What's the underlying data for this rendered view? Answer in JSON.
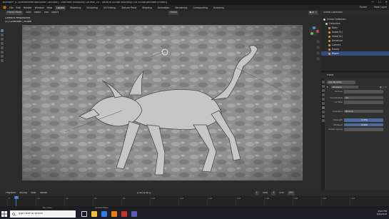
{
  "window": {
    "title": "Blender* [C:\\BlenderMentals\\New Concept] - Ultimate Sculpting Course\\ 20 - Second Sculpt Blocking Out Sculpt\\Blender\\Edited]",
    "controls": [
      "—",
      "☐",
      "✕"
    ]
  },
  "menubar": {
    "items": [
      "File",
      "Edit",
      "Render",
      "Window",
      "Help"
    ],
    "workspaces": [
      "Layout",
      "Modeling",
      "Sculpting",
      "UV Editing",
      "Texture Paint",
      "Shading",
      "Animation",
      "Rendering",
      "Compositing",
      "Scripting"
    ],
    "active_workspace": "Layout",
    "scene": "Scene",
    "view_layer": "View Layer"
  },
  "viewport": {
    "mode": "Object Mode",
    "menus": [
      "View",
      "Select",
      "Add",
      "Object"
    ],
    "transform": "Global",
    "info_line1": "Camera Perspective",
    "info_line2": "(1) Collection | Hupm"
  },
  "outliner": {
    "header": "Scene Collection",
    "items": [
      {
        "label": "Scene Collection",
        "color": "#c8c8c8",
        "selected": false
      },
      {
        "label": "Collection",
        "color": "#c8c8c8",
        "selected": false
      },
      {
        "label": "Body",
        "color": "#e69a3d",
        "selected": false
      },
      {
        "label": "Head(01)",
        "color": "#e69a3d",
        "selected": false
      },
      {
        "label": "Head(01)",
        "color": "#e69a3d",
        "selected": false
      },
      {
        "label": "Armature",
        "color": "#e69a3d",
        "selected": false
      },
      {
        "label": "Camera",
        "color": "#e69a3d",
        "selected": false
      },
      {
        "label": "Empty",
        "color": "#e69a3d",
        "selected": false
      },
      {
        "label": "Hupm",
        "color": "#e69a3d",
        "selected": true
      }
    ]
  },
  "properties": {
    "header": "Plane",
    "add_modifier": "Add Modifier",
    "modifier_name": "Displace",
    "texture_label": "Texture",
    "coordinates_label": "Coordinates",
    "coordinates_value": "UV",
    "uv_map_label": "UV Map",
    "direction_label": "Direction",
    "direction_value": "Normal",
    "strength_label": "Strength",
    "strength_value": "0.350",
    "midlevel_label": "Midlevel",
    "midlevel_value": "0.500",
    "vertex_group_label": "Vertex Group"
  },
  "timeline": {
    "menus": [
      "Playback",
      "Keying",
      "View",
      "Marker"
    ],
    "current_frame": "1",
    "start_label": "Start",
    "start": "1",
    "end_label": "End",
    "end": "250",
    "ticks": [
      "0",
      "20",
      "40",
      "60",
      "80",
      "100",
      "120",
      "140",
      "160",
      "180",
      "200",
      "220",
      "240"
    ]
  },
  "status": {
    "left": "Pan View",
    "middle": "Context Menu"
  },
  "taskbar": {
    "search_placeholder": "Type here to search",
    "time": "3:05 PM",
    "date": "4/5/2020"
  },
  "colors": {
    "accent": "#4b78c0",
    "selection": "#334d80",
    "object_orange": "#e69a3d"
  }
}
